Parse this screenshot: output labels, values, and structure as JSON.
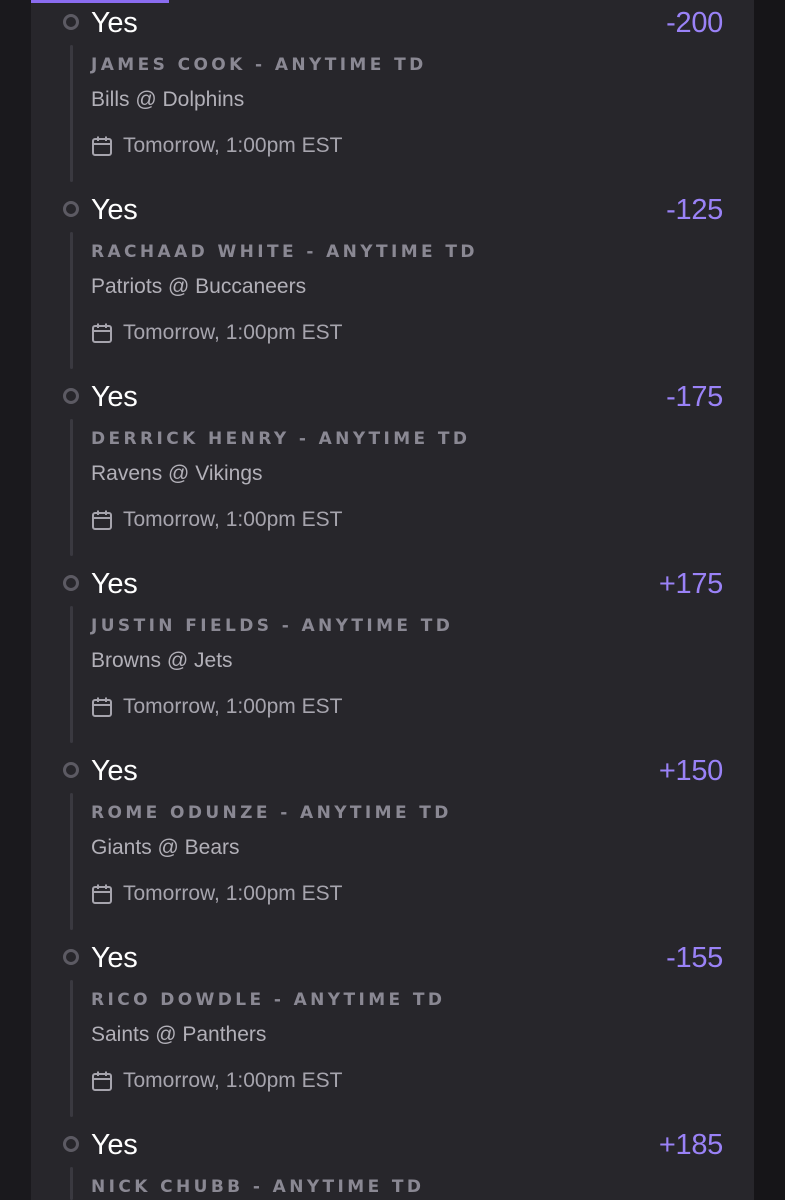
{
  "colors": {
    "background": "#1a191d",
    "panel": "#27262b",
    "accent": "#9a82f7",
    "pick_text": "#ffffff",
    "market_text": "#8a8893",
    "secondary_text": "#b2b0b8"
  },
  "icons": {
    "leg_status": "circle-outline-icon",
    "schedule": "calendar-icon"
  },
  "legs": [
    {
      "pick": "Yes",
      "odds": "-200",
      "market": "JAMES COOK - ANYTIME TD",
      "game": "Bills @ Dolphins",
      "time": "Tomorrow, 1:00pm EST"
    },
    {
      "pick": "Yes",
      "odds": "-125",
      "market": "RACHAAD WHITE - ANYTIME TD",
      "game": "Patriots @ Buccaneers",
      "time": "Tomorrow, 1:00pm EST"
    },
    {
      "pick": "Yes",
      "odds": "-175",
      "market": "DERRICK HENRY - ANYTIME TD",
      "game": "Ravens @ Vikings",
      "time": "Tomorrow, 1:00pm EST"
    },
    {
      "pick": "Yes",
      "odds": "+175",
      "market": "JUSTIN FIELDS - ANYTIME TD",
      "game": "Browns @ Jets",
      "time": "Tomorrow, 1:00pm EST"
    },
    {
      "pick": "Yes",
      "odds": "+150",
      "market": "ROME ODUNZE - ANYTIME TD",
      "game": "Giants @ Bears",
      "time": "Tomorrow, 1:00pm EST"
    },
    {
      "pick": "Yes",
      "odds": "-155",
      "market": "RICO DOWDLE - ANYTIME TD",
      "game": "Saints @ Panthers",
      "time": "Tomorrow, 1:00pm EST"
    },
    {
      "pick": "Yes",
      "odds": "+185",
      "market": "NICK CHUBB - ANYTIME TD",
      "game": "",
      "time": ""
    }
  ]
}
